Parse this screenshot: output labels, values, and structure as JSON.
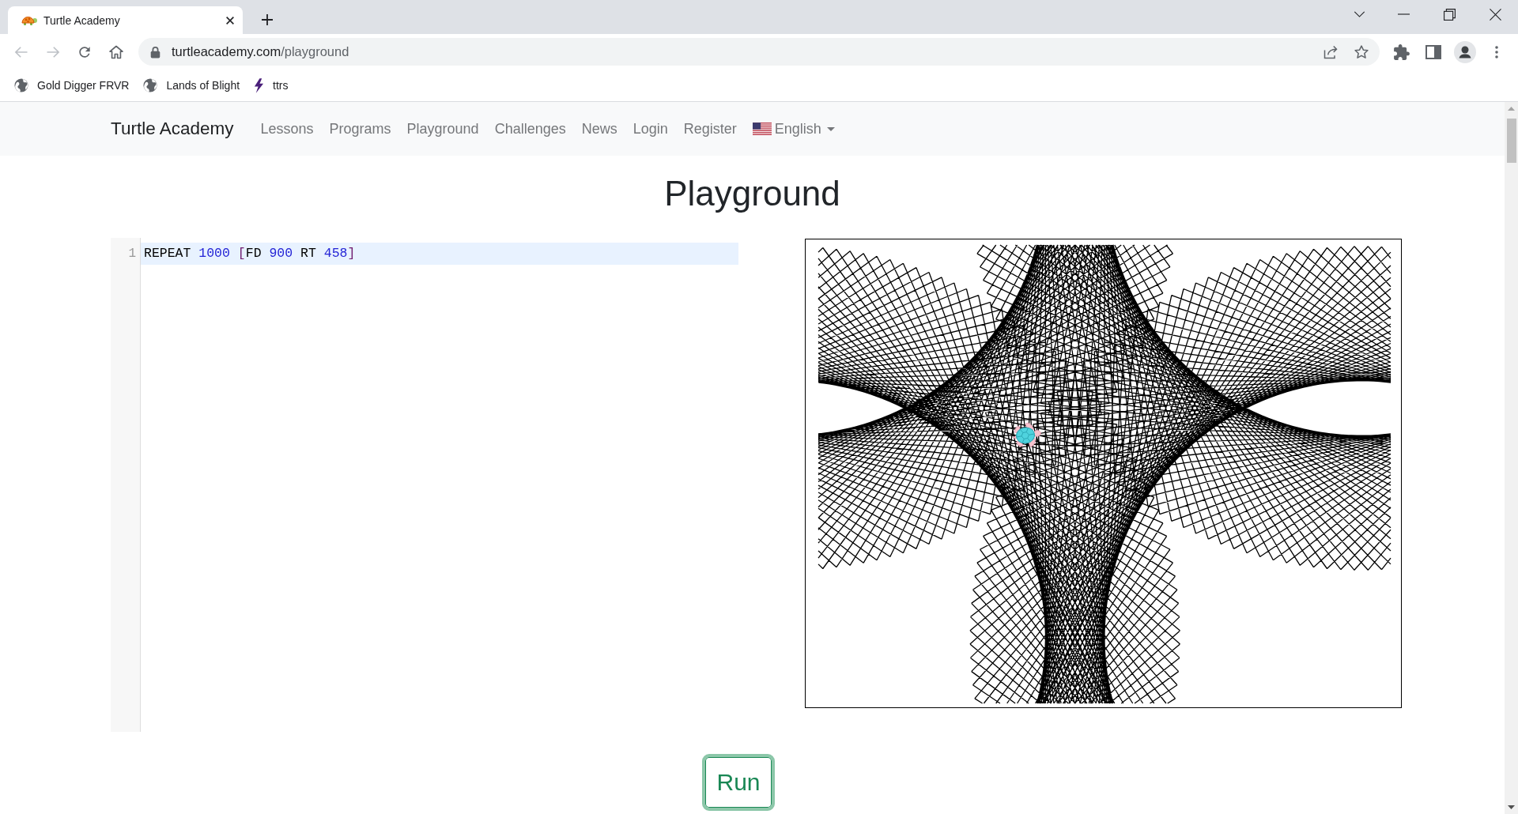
{
  "browser": {
    "tab": {
      "title": "Turtle Academy"
    },
    "toolbar": [
      {
        "kind": "back",
        "disabled": true
      },
      {
        "kind": "forward",
        "disabled": true
      },
      {
        "kind": "reload",
        "disabled": false
      },
      {
        "kind": "home",
        "disabled": false
      }
    ],
    "address": {
      "host": "turtleacademy.com",
      "path": "/playground"
    },
    "bookmarks": [
      {
        "label": "Gold Digger FRVR",
        "kind": "globe"
      },
      {
        "label": "Lands of Blight",
        "kind": "globe"
      },
      {
        "label": "ttrs",
        "kind": "bolt"
      }
    ]
  },
  "navbar": {
    "brand": "Turtle Academy",
    "links": [
      {
        "label": "Lessons"
      },
      {
        "label": "Programs"
      },
      {
        "label": "Playground"
      },
      {
        "label": "Challenges"
      },
      {
        "label": "News"
      },
      {
        "label": "Login"
      },
      {
        "label": "Register"
      }
    ],
    "language": {
      "label": "English"
    }
  },
  "title": "Playground",
  "editor": {
    "lines": [
      {
        "number": "1",
        "active": true,
        "tokens": [
          {
            "text": "REPEAT ",
            "kind": "keyword"
          },
          {
            "text": "1000 ",
            "kind": "number"
          },
          {
            "text": "[",
            "kind": "bracket"
          },
          {
            "text": "FD ",
            "kind": "keyword"
          },
          {
            "text": "900 ",
            "kind": "number"
          },
          {
            "text": "RT ",
            "kind": "keyword"
          },
          {
            "text": "458",
            "kind": "number"
          },
          {
            "text": "]",
            "kind": "bracket"
          }
        ]
      }
    ]
  },
  "run_button": {
    "label": "Run"
  }
}
